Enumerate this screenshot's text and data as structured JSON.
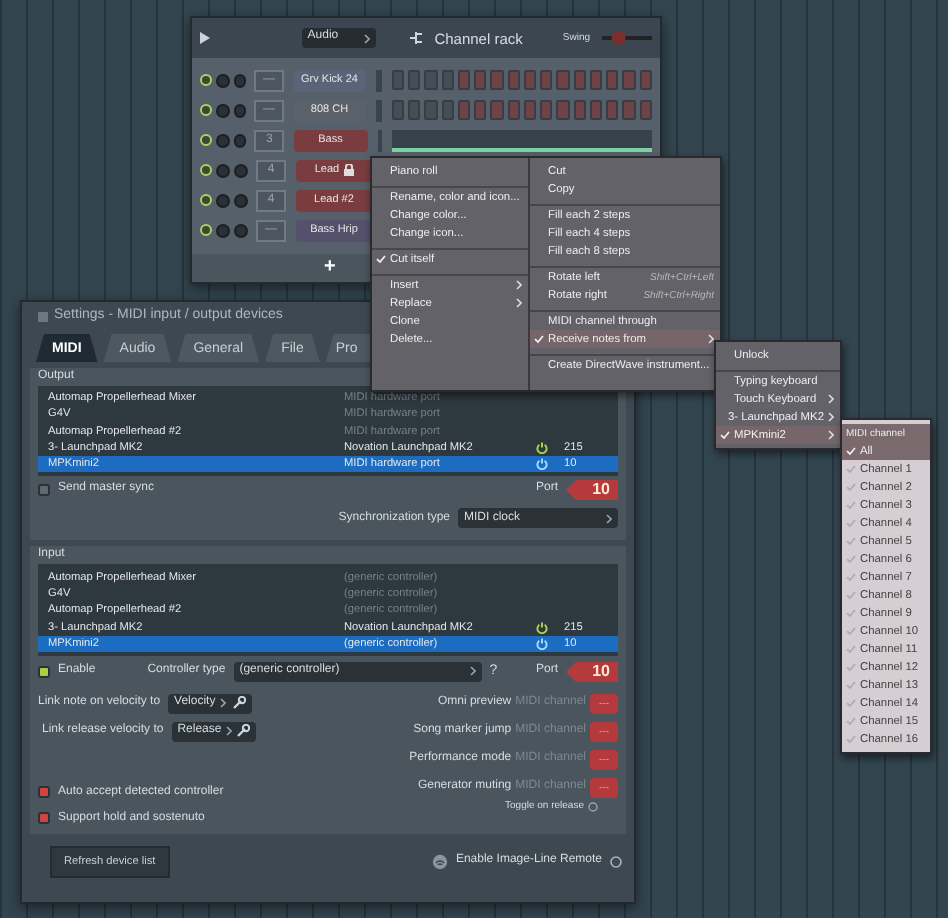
{
  "channel_rack": {
    "title": "Channel rack",
    "source": "Audio",
    "swing_label": "Swing",
    "swing": {
      "level": 0.25
    },
    "add_label": "+",
    "channels": [
      {
        "kind": "steps",
        "number": "—",
        "name": "Grv Kick 24",
        "color": "#5a6478",
        "locked": false
      },
      {
        "kind": "steps",
        "number": "—",
        "name": "808 CH",
        "color": "#5b6169",
        "locked": false
      },
      {
        "kind": "roll",
        "number": "3",
        "name": "Bass",
        "color": "#7a3c3f",
        "locked": false
      },
      {
        "kind": "covered",
        "number": "4",
        "name": "Lead",
        "color": "#7a3c3f",
        "locked": true
      },
      {
        "kind": "covered",
        "number": "4",
        "name": "Lead #2",
        "color": "#7a3c3f",
        "locked": false
      },
      {
        "kind": "covered",
        "number": "—",
        "name": "Bass Hrip",
        "color": "#55506c",
        "locked": false
      }
    ]
  },
  "context_menu": {
    "left": [
      {
        "label": "Piano roll",
        "checked": false,
        "submenu": false,
        "selected": false,
        "divider_before": false
      },
      {
        "label": "Rename, color and icon...",
        "checked": false,
        "submenu": false,
        "selected": false,
        "divider_before": true
      },
      {
        "label": "Change color...",
        "checked": false,
        "submenu": false,
        "selected": false,
        "divider_before": false
      },
      {
        "label": "Change icon...",
        "checked": false,
        "submenu": false,
        "selected": false,
        "divider_before": false
      },
      {
        "label": "Cut itself",
        "checked": true,
        "submenu": false,
        "selected": false,
        "divider_before": true
      },
      {
        "label": "Insert",
        "checked": false,
        "submenu": true,
        "selected": false,
        "divider_before": true
      },
      {
        "label": "Replace",
        "checked": false,
        "submenu": true,
        "selected": false,
        "divider_before": false
      },
      {
        "label": "Clone",
        "checked": false,
        "submenu": false,
        "selected": false,
        "divider_before": false
      },
      {
        "label": "Delete...",
        "checked": false,
        "submenu": false,
        "selected": false,
        "divider_before": false
      }
    ],
    "right": [
      {
        "label": "Cut",
        "checked": false,
        "submenu": false,
        "selected": false,
        "divider_before": false
      },
      {
        "label": "Copy",
        "checked": false,
        "submenu": false,
        "selected": false,
        "divider_before": false
      },
      {
        "label": "Fill each 2 steps",
        "checked": false,
        "submenu": false,
        "selected": false,
        "divider_before": true
      },
      {
        "label": "Fill each 4 steps",
        "checked": false,
        "submenu": false,
        "selected": false,
        "divider_before": false
      },
      {
        "label": "Fill each 8 steps",
        "checked": false,
        "submenu": false,
        "selected": false,
        "divider_before": false
      },
      {
        "label": "Rotate left",
        "shortcut": "Shift+Ctrl+Left",
        "checked": false,
        "submenu": false,
        "selected": false,
        "divider_before": true
      },
      {
        "label": "Rotate right",
        "shortcut": "Shift+Ctrl+Right",
        "checked": false,
        "submenu": false,
        "selected": false,
        "divider_before": false
      },
      {
        "label": "MIDI channel through",
        "checked": false,
        "submenu": false,
        "selected": false,
        "divider_before": true
      },
      {
        "label": "Receive notes from",
        "checked": true,
        "submenu": true,
        "selected": true,
        "divider_before": false
      },
      {
        "label": "Create DirectWave instrument...",
        "checked": false,
        "submenu": false,
        "selected": false,
        "divider_before": true
      }
    ]
  },
  "source_menu": {
    "items": [
      {
        "label": "Unlock",
        "checked": false,
        "submenu": false,
        "selected": false,
        "divider_before": false
      },
      {
        "label": "Typing keyboard",
        "checked": false,
        "submenu": false,
        "selected": false,
        "divider_before": true
      },
      {
        "label": "Touch Keyboard",
        "checked": false,
        "submenu": true,
        "selected": false,
        "divider_before": false
      },
      {
        "label": "3- Launchpad MK2",
        "checked": false,
        "submenu": true,
        "selected": false,
        "divider_before": false
      },
      {
        "label": "MPKmini2",
        "checked": true,
        "submenu": true,
        "selected": true,
        "divider_before": false
      }
    ]
  },
  "channel_menu": {
    "header": "MIDI channel",
    "items": [
      {
        "label": "All",
        "checked": true,
        "selected": true
      },
      {
        "label": "Channel 1",
        "checked": false,
        "selected": false
      },
      {
        "label": "Channel 2",
        "checked": false,
        "selected": false
      },
      {
        "label": "Channel 3",
        "checked": false,
        "selected": false
      },
      {
        "label": "Channel 4",
        "checked": false,
        "selected": false
      },
      {
        "label": "Channel 5",
        "checked": false,
        "selected": false
      },
      {
        "label": "Channel 6",
        "checked": false,
        "selected": false
      },
      {
        "label": "Channel 7",
        "checked": false,
        "selected": false
      },
      {
        "label": "Channel 8",
        "checked": false,
        "selected": false
      },
      {
        "label": "Channel 9",
        "checked": false,
        "selected": false
      },
      {
        "label": "Channel 10",
        "checked": false,
        "selected": false
      },
      {
        "label": "Channel 11",
        "checked": false,
        "selected": false
      },
      {
        "label": "Channel 12",
        "checked": false,
        "selected": false
      },
      {
        "label": "Channel 13",
        "checked": false,
        "selected": false
      },
      {
        "label": "Channel 14",
        "checked": false,
        "selected": false
      },
      {
        "label": "Channel 15",
        "checked": false,
        "selected": false
      },
      {
        "label": "Channel 16",
        "checked": false,
        "selected": false
      }
    ]
  },
  "settings": {
    "title": "Settings - MIDI input / output devices",
    "tabs": [
      {
        "label": "MIDI",
        "selected": true
      },
      {
        "label": "Audio",
        "selected": false
      },
      {
        "label": "General",
        "selected": false
      },
      {
        "label": "File",
        "selected": false
      },
      {
        "label": "Pro",
        "selected": false
      }
    ],
    "output": {
      "title": "Output",
      "devices": [
        {
          "name": "Automap Propellerhead Mixer",
          "type": "MIDI hardware port",
          "active": false,
          "selected": false
        },
        {
          "name": "G4V",
          "type": "MIDI hardware port",
          "active": false,
          "selected": false
        },
        {
          "name": "Automap Propellerhead #2",
          "type": "MIDI hardware port",
          "active": false,
          "selected": false
        },
        {
          "name": "3- Launchpad MK2",
          "type": "Novation Launchpad MK2",
          "active": true,
          "selected": false,
          "port": "215"
        },
        {
          "name": "MPKmini2",
          "type": "MIDI hardware port",
          "active": true,
          "selected": true,
          "port": "10"
        }
      ],
      "send_master_sync": {
        "label": "Send master sync",
        "checked": false
      },
      "port_label": "Port",
      "port": "10",
      "sync_label": "Synchronization type",
      "sync_value": "MIDI clock"
    },
    "input": {
      "title": "Input",
      "devices": [
        {
          "name": "Automap Propellerhead Mixer",
          "type": "(generic controller)",
          "active": false,
          "selected": false
        },
        {
          "name": "G4V",
          "type": "(generic controller)",
          "active": false,
          "selected": false
        },
        {
          "name": "Automap Propellerhead #2",
          "type": "(generic controller)",
          "active": false,
          "selected": false
        },
        {
          "name": "3- Launchpad MK2",
          "type": "Novation Launchpad MK2",
          "active": true,
          "selected": false,
          "port": "215"
        },
        {
          "name": "MPKmini2",
          "type": "(generic controller)",
          "active": true,
          "selected": true,
          "port": "10"
        }
      ],
      "enable": {
        "label": "Enable",
        "checked": true
      },
      "controller_label": "Controller type",
      "controller_value": "(generic controller)",
      "help": "?",
      "port_label": "Port",
      "port": "10",
      "links": [
        {
          "label": "Link note on velocity to",
          "value": "Velocity"
        },
        {
          "label": "Link release velocity to",
          "value": "Release"
        }
      ],
      "options": [
        {
          "label": "Auto accept detected controller",
          "checked": true
        },
        {
          "label": "Support hold and sostenuto",
          "checked": true
        }
      ],
      "channels": [
        {
          "label": "Omni preview",
          "hint": "MIDI channel",
          "value": "---"
        },
        {
          "label": "Song marker jump",
          "hint": "MIDI channel",
          "value": "---"
        },
        {
          "label": "Performance mode",
          "hint": "MIDI channel",
          "value": "---"
        },
        {
          "label": "Generator muting",
          "hint": "MIDI channel",
          "value": "---"
        }
      ],
      "toggle_label": "Toggle on release"
    },
    "refresh_button": "Refresh device list",
    "remote": {
      "label": "Enable Image-Line Remote",
      "checked": false
    }
  }
}
